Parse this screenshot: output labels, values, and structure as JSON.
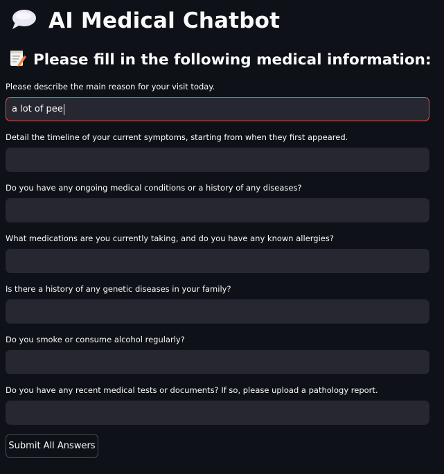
{
  "header": {
    "icon": "speech-bubble-icon",
    "title": "AI Medical Chatbot"
  },
  "form": {
    "icon": "memo-icon",
    "heading": "Please fill in the following medical information:",
    "questions": [
      {
        "label": "Please describe the main reason for your visit today.",
        "value": "a lot of pee"
      },
      {
        "label": "Detail the timeline of your current symptoms, starting from when they first appeared.",
        "value": ""
      },
      {
        "label": "Do you have any ongoing medical conditions or a history of any diseases?",
        "value": ""
      },
      {
        "label": "What medications are you currently taking, and do you have any known allergies?",
        "value": ""
      },
      {
        "label": "Is there a history of any genetic diseases in your family?",
        "value": ""
      },
      {
        "label": "Do you smoke or consume alcohol regularly?",
        "value": ""
      },
      {
        "label": "Do you have any recent medical tests or documents? If so, please upload a pathology report.",
        "value": ""
      }
    ],
    "submit_label": "Submit All Answers"
  },
  "colors": {
    "background": "#0e1117",
    "input_background": "#262730",
    "focus_border": "#ff4b4b",
    "text": "#fafafa"
  }
}
